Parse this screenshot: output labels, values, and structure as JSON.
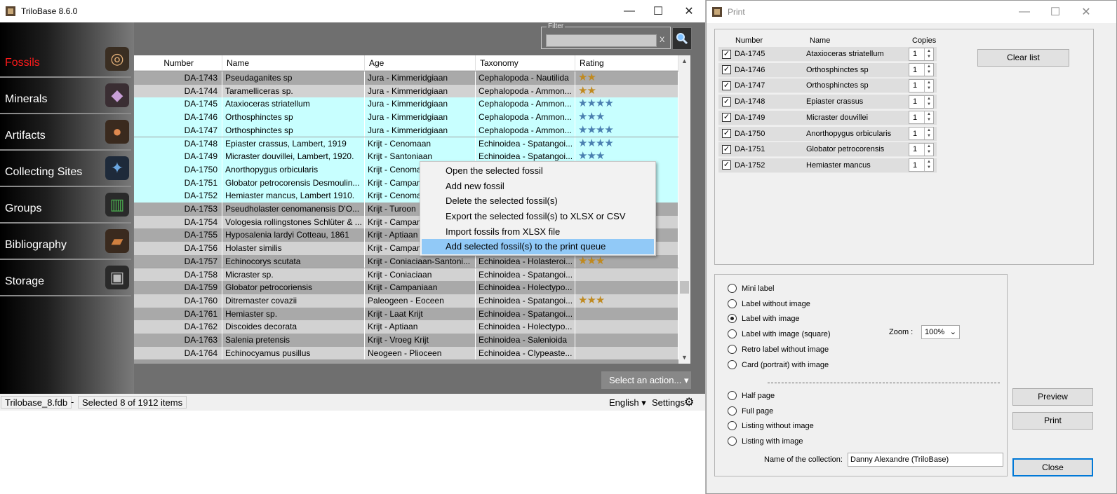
{
  "main": {
    "title": "TriloBase 8.6.0",
    "nav": [
      {
        "label": "Fossils",
        "icon": "ammonite-icon"
      },
      {
        "label": "Minerals",
        "icon": "crystal-icon"
      },
      {
        "label": "Artifacts",
        "icon": "pot-icon"
      },
      {
        "label": "Collecting Sites",
        "icon": "compass-icon"
      },
      {
        "label": "Groups",
        "icon": "books-icon"
      },
      {
        "label": "Bibliography",
        "icon": "book-icon"
      },
      {
        "label": "Storage",
        "icon": "safe-icon"
      }
    ],
    "filter_legend": "Filter",
    "filter_value": "",
    "filter_clear": "X",
    "columns": [
      "Number",
      "Name",
      "Age",
      "Taxonomy",
      "Rating"
    ],
    "rows": [
      [
        "DA-1743",
        "Pseudaganites sp",
        "Jura - Kimmeridgiaan",
        "Cephalopoda - Nautilida",
        "★★"
      ],
      [
        "DA-1744",
        "Taramelliceras sp.",
        "Jura - Kimmeridgiaan",
        "Cephalopoda - Ammon...",
        "★★"
      ],
      [
        "DA-1745",
        "Ataxioceras striatellum",
        "Jura - Kimmeridgiaan",
        "Cephalopoda - Ammon...",
        "★★★★"
      ],
      [
        "DA-1746",
        "Orthosphinctes sp",
        "Jura - Kimmeridgiaan",
        "Cephalopoda - Ammon...",
        "★★★"
      ],
      [
        "DA-1747",
        "Orthosphinctes sp",
        "Jura - Kimmeridgiaan",
        "Cephalopoda - Ammon...",
        "★★★★"
      ],
      [
        "DA-1748",
        "Epiaster crassus, Lambert, 1919",
        "Krijt - Cenomaan",
        "Echinoidea - Spatangoi...",
        "★★★★"
      ],
      [
        "DA-1749",
        "Micraster douvillei, Lambert, 1920.",
        "Krijt - Santoniaan",
        "Echinoidea - Spatangoi...",
        "★★★"
      ],
      [
        "DA-1750",
        "Anorthopygus orbicularis",
        "Krijt - Cenomaan",
        "",
        ""
      ],
      [
        "DA-1751",
        "Globator petrocorensis Desmoulin...",
        "Krijt - Campaniaan",
        "",
        ""
      ],
      [
        "DA-1752",
        "Hemiaster mancus, Lambert 1910.",
        "Krijt - Cenomaan",
        "",
        ""
      ],
      [
        "DA-1753",
        "Pseudholaster cenomanensis D'O...",
        "Krijt - Turoon",
        "",
        ""
      ],
      [
        "DA-1754",
        "Vologesia rollingstones Schlüter & ...",
        "Krijt - Campaniaan",
        "",
        ""
      ],
      [
        "DA-1755",
        "Hyposalenia lardyi Cotteau, 1861",
        "Krijt - Aptiaan",
        "",
        ""
      ],
      [
        "DA-1756",
        "Holaster similis",
        "Krijt - Campaniaan",
        "",
        ""
      ],
      [
        "DA-1757",
        "Echinocorys scutata",
        "Krijt - Coniaciaan-Santoni...",
        "Echinoidea - Holasteroi...",
        "★★★"
      ],
      [
        "DA-1758",
        "Micraster sp.",
        "Krijt - Coniaciaan",
        "Echinoidea - Spatangoi...",
        ""
      ],
      [
        "DA-1759",
        "Globator petrocoriensis",
        "Krijt - Campaniaan",
        "Echinoidea - Holectypo...",
        ""
      ],
      [
        "DA-1760",
        "Ditremaster covazii",
        "Paleogeen - Eoceen",
        "Echinoidea - Spatangoi...",
        "★★★"
      ],
      [
        "DA-1761",
        "Hemiaster sp.",
        "Krijt - Laat Krijt",
        "Echinoidea - Spatangoi...",
        ""
      ],
      [
        "DA-1762",
        "Discoides decorata",
        "Krijt - Aptiaan",
        "Echinoidea - Holectypo...",
        ""
      ],
      [
        "DA-1763",
        "Salenia pretensis",
        "Krijt - Vroeg Krijt",
        "Echinoidea - Salenioida",
        ""
      ],
      [
        "DA-1764",
        "Echinocyamus pusillus",
        "Neogeen - Plioceen",
        "Echinoidea - Clypeaste...",
        ""
      ]
    ],
    "action_label": "Select an action... ▾",
    "context_menu": [
      "Open the selected fossil",
      "Add new fossil",
      "Delete the selected fossil(s)",
      "Export the selected fossil(s) to XLSX or CSV",
      "Import fossils from XLSX file",
      "Add selected fossil(s) to the print queue"
    ],
    "status": {
      "file": "Trilobase_8.fdb",
      "dash": "-",
      "selection": "Selected 8 of 1912 items",
      "language": "English ▾",
      "settings": "Settings"
    }
  },
  "print": {
    "title": "Print",
    "columns": [
      "Number",
      "Name",
      "Copies"
    ],
    "items": [
      {
        "number": "DA-1745",
        "name": "Ataxioceras striatellum",
        "copies": "1"
      },
      {
        "number": "DA-1746",
        "name": "Orthosphinctes sp",
        "copies": "1"
      },
      {
        "number": "DA-1747",
        "name": "Orthosphinctes sp",
        "copies": "1"
      },
      {
        "number": "DA-1748",
        "name": "Epiaster crassus",
        "copies": "1"
      },
      {
        "number": "DA-1749",
        "name": "Micraster douvillei",
        "copies": "1"
      },
      {
        "number": "DA-1750",
        "name": "Anorthopygus orbicularis",
        "copies": "1"
      },
      {
        "number": "DA-1751",
        "name": "Globator petrocorensis",
        "copies": "1"
      },
      {
        "number": "DA-1752",
        "name": "Hemiaster mancus",
        "copies": "1"
      }
    ],
    "clear_label": "Clear list",
    "options": [
      "Mini label",
      "Label without image",
      "Label with image",
      "Label with image (square)",
      "Retro label without image",
      "Card (portrait) with image",
      "Half page",
      "Full page",
      "Listing without image",
      "Listing with image"
    ],
    "selected_option": "Label with image",
    "zoom_label": "Zoom :",
    "zoom_value": "100%",
    "collection_label": "Name of the collection:",
    "collection_value": "Danny Alexandre (TriloBase)",
    "preview_label": "Preview",
    "print_label": "Print",
    "close_label": "Close"
  }
}
